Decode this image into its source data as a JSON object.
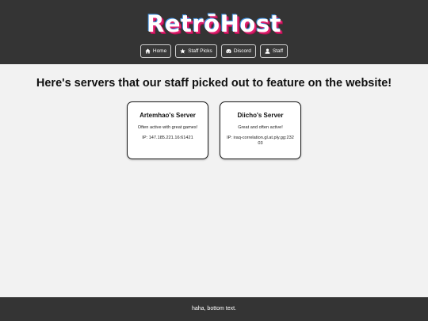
{
  "header": {
    "logo_text": "RetrōHost",
    "nav": [
      {
        "label": "Home",
        "icon": "home-icon"
      },
      {
        "label": "Staff Picks",
        "icon": "star-icon"
      },
      {
        "label": "Discord",
        "icon": "discord-icon"
      },
      {
        "label": "Staff",
        "icon": "user-icon"
      }
    ]
  },
  "main": {
    "heading": "Here's servers that our staff picked out to feature on the website!",
    "servers": [
      {
        "name": "Artemhao's Server",
        "description": "Often active with great games!",
        "ip": "IP: 147.185.221.16:61421"
      },
      {
        "name": "Diicho's Server",
        "description": "Great and often active!",
        "ip": "IP: iraq-correlation.gl.at.ply.gg:23203"
      }
    ]
  },
  "footer": {
    "text": "haha, bottom text."
  },
  "colors": {
    "header_bg": "#343434",
    "page_bg": "#f2f2f2",
    "logo_accent_pink": "#e0206e",
    "logo_accent_blue": "#3d8fe0"
  }
}
